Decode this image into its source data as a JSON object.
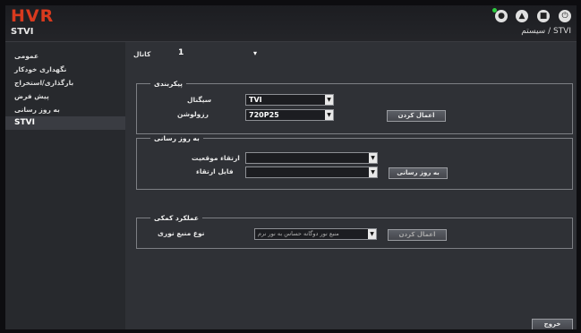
{
  "header": {
    "logo": "HVR",
    "title": "STVI",
    "breadcrumb": "سیستم / STVI"
  },
  "toolbar_icons": [
    "status-icon",
    "alarm-icon",
    "storage-icon",
    "power-icon"
  ],
  "sidebar": {
    "items": [
      {
        "label": "عمومی"
      },
      {
        "label": "نگهداری خودکار"
      },
      {
        "label": "بارگذاری/استخراج"
      },
      {
        "label": "پیش فرض"
      },
      {
        "label": "به روز رسانی"
      },
      {
        "label": "STVI"
      }
    ]
  },
  "channel": {
    "label": "کانال",
    "value": "1"
  },
  "config": {
    "title": "پیکربندی",
    "signal": {
      "label": "سیگنال",
      "value": "TVI"
    },
    "resolution": {
      "label": "رزولوشن",
      "value": "720P25"
    },
    "apply_label": "اعمال کردن"
  },
  "update": {
    "title": "به روز رسانی",
    "location": {
      "label": "ارتقاء موقعیت",
      "value": ""
    },
    "file": {
      "label": "فایل ارتقاء",
      "value": ""
    },
    "button_label": "به روز رسانی"
  },
  "perf": {
    "title": "عملکرد کمکی",
    "light": {
      "label": "نوع منبع نوری",
      "value": "منبع نور دوگانه حساس به نور نرم"
    },
    "apply_label": "اعمال کردن"
  },
  "footer": {
    "exit_label": "خروج"
  }
}
